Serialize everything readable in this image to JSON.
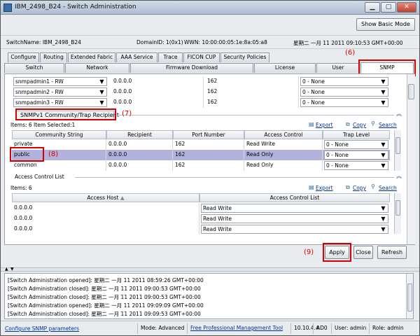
{
  "window": {
    "title": "IBM_2498_B24 - Switch Administration"
  },
  "header": {
    "basic_mode_button": "Show Basic Mode"
  },
  "info": {
    "switch_name": "SwitchName: IBM_2498_B24",
    "domain_id": "DomainID: 1(0x1)",
    "wwn": "WWN: 10:00:00:05:1e:8a:05:a8",
    "datetime": "星期二 一月 11 2011 09:10:53 GMT+00:00"
  },
  "tabs_row1": [
    "Configure",
    "Routing",
    "Extended Fabric",
    "AAA Service",
    "Trace",
    "FICON CUP",
    "Security Policies"
  ],
  "tabs_row2": [
    "Switch",
    "Network",
    "Firmware Download",
    "License",
    "User",
    "SNMP"
  ],
  "snmpv3_rows": [
    {
      "user": "snmpadmin1 - RW",
      "ip": "0.0.0.0",
      "port": "162",
      "level": "0 - None"
    },
    {
      "user": "snmpadmin2 - RW",
      "ip": "0.0.0.0",
      "port": "162",
      "level": "0 - None"
    },
    {
      "user": "snmpadmin3 - RW",
      "ip": "0.0.0.0",
      "port": "162",
      "level": "0 - None"
    }
  ],
  "community": {
    "section_title": "SNMPv1 Community/Trap Recipient",
    "items_text": "Items: 6 Item Selected:1",
    "columns": [
      "Community String",
      "Recipient",
      "Port Number",
      "Access Control",
      "Trap Level"
    ],
    "rows": [
      {
        "community": "private",
        "recipient": "0.0.0.0",
        "port": "162",
        "access": "Read Write",
        "trap": "0 - None"
      },
      {
        "community": "public",
        "recipient": "0.0.0.0",
        "port": "162",
        "access": "Read Only",
        "trap": "0 - None"
      },
      {
        "community": "common",
        "recipient": "0.0.0.0",
        "port": "162",
        "access": "Read Only",
        "trap": "0 - None"
      }
    ]
  },
  "acl": {
    "section_title": "Access Control List",
    "items_text": "Items: 6",
    "columns": [
      "Access Host",
      "Access Control List"
    ],
    "rows": [
      {
        "host": "0.0.0.0",
        "acl": "Read Write"
      },
      {
        "host": "0.0.0.0",
        "acl": "Read Write"
      },
      {
        "host": "0.0.0.0",
        "acl": "Read Write"
      }
    ]
  },
  "actions": {
    "export": "Export",
    "copy": "Copy",
    "search": "Search"
  },
  "buttons": {
    "apply": "Apply",
    "close": "Close",
    "refresh": "Refresh"
  },
  "annotations": {
    "n6": "(6)",
    "n7": "(7)",
    "n8": "(8)",
    "n9": "(9)"
  },
  "log": [
    "[Switch Administration opened]: 星期二 一月 11 2011 08:59:26 GMT+00:00",
    "[Switch Administration closed]: 星期二 一月 11 2011 09:00:53 GMT+00:00",
    "[Switch Administration closed]: 星期二 一月 11 2011 09:00:53 GMT+00:00",
    "[Switch Administration opened]: 星期二 一月 11 2011 09:09:09 GMT+00:00",
    "[Switch Administration closed]: 星期二 一月 11 2011 09:09:53 GMT+00:00"
  ],
  "status": {
    "left": "Configure SNMP parameters",
    "mode": "Mode: Advanced",
    "tool": "Free Professional Management Tool",
    "ip": "10.10.4.4",
    "ad": "AD0",
    "user": "User: admin",
    "role": "Role: admin"
  },
  "colors": {
    "accent": "#d40000",
    "selection": "#b2b2dd",
    "link": "#003399"
  }
}
